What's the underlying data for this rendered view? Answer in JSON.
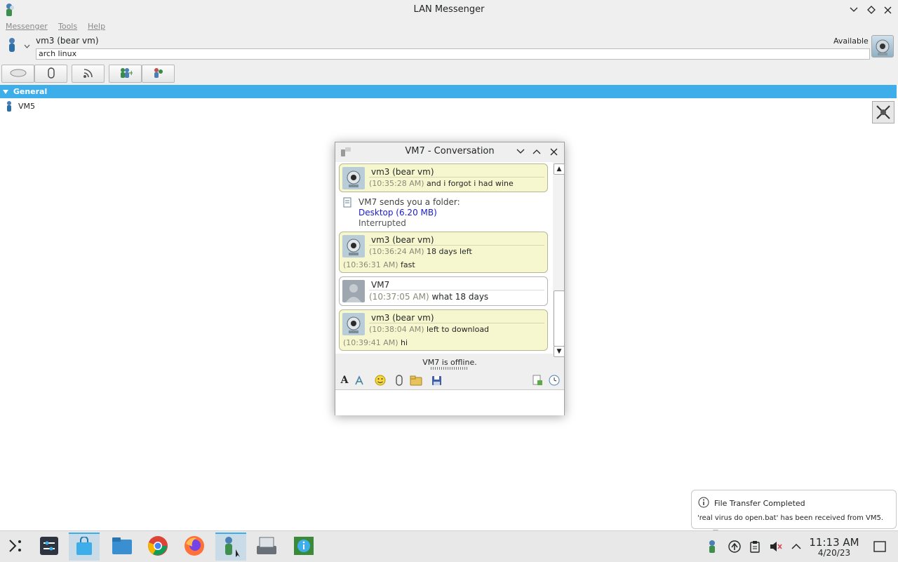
{
  "window": {
    "title": "LAN Messenger",
    "menu": [
      "Messenger",
      "Tools",
      "Help"
    ]
  },
  "profile": {
    "name": "vm3 (bear vm)",
    "note": "arch linux",
    "status": "Available"
  },
  "group": {
    "name": "General",
    "contacts": [
      "VM5"
    ]
  },
  "conversation": {
    "title": "VM7 - Conversation",
    "messages": [
      {
        "sender": "vm3 (bear vm)",
        "lines": [
          {
            "ts": "(10:35:28 AM)",
            "text": "and i forgot i had wine"
          }
        ]
      },
      {
        "sender": "vm3 (bear vm)",
        "lines": [
          {
            "ts": "(10:36:24 AM)",
            "text": "18 days left"
          },
          {
            "ts": "(10:36:31 AM)",
            "text": "fast"
          }
        ]
      },
      {
        "sender": "VM7",
        "lines": [
          {
            "ts": "(10:37:05 AM)",
            "text": "what 18 days"
          }
        ]
      },
      {
        "sender": "vm3 (bear vm)",
        "lines": [
          {
            "ts": "(10:38:04 AM)",
            "text": "left to download"
          },
          {
            "ts": "(10:39:41 AM)",
            "text": "hi"
          }
        ]
      }
    ],
    "file_transfer": {
      "heading": "VM7 sends you a folder:",
      "link": "Desktop (6.20 MB)",
      "state": "Interrupted"
    },
    "status_line": "VM7 is offline."
  },
  "notification": {
    "title": "File Transfer Completed",
    "body": "'real virus do open.bat' has been received from VM5."
  },
  "clock": {
    "time": "11:13 AM",
    "date": "4/20/23"
  },
  "colors": {
    "accent": "#3daee9",
    "bubble_own": "#f7f7cf",
    "link": "#1a1ad0"
  }
}
